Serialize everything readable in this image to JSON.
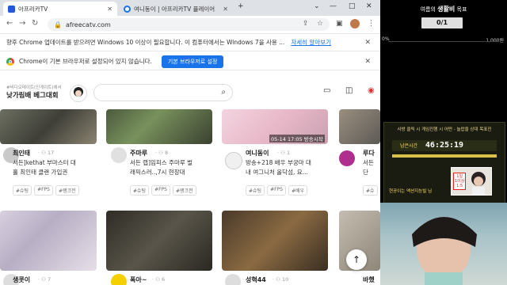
{
  "tabs": [
    {
      "label": "아프리카TV",
      "active": true
    },
    {
      "label": "여니동이 | 아프리카TV 플레이어",
      "active": false
    }
  ],
  "url": "afreecatv.com",
  "update_bar": {
    "text": "향후 Chrome 업데이트를 받으려면 Windows 10 이상이 필요합니다. 이 컴퓨터에서는 Windows 7을 사용 ...",
    "link": "자세히 알아보기"
  },
  "default_bar": {
    "text": "Chrome이 기본 브라우저로 설정되어 있지 않습니다.",
    "button": "기본 브라우저로 설정"
  },
  "header": {
    "logo_small": "#비디오테이트(인게이트)에서",
    "logo_big": "낮가림배 베그대회"
  },
  "cards_row1": [
    {
      "name": "최인태",
      "views": "17",
      "title1": "서든]kethat 부마스터 대",
      "title2": "홀 최인태 클랜 가입권",
      "tags": [
        "#슈팅",
        "#FPS",
        "#랭크전"
      ]
    },
    {
      "name": "주마루",
      "views": "8",
      "title1": "서든 랩]임피스 주마루 벌",
      "title2": "래픽스러..,7시 현장대",
      "tags": [
        "#슈팅",
        "#FPS",
        "#랭크전"
      ]
    },
    {
      "name": "여니동이",
      "views": "1",
      "title1": "방송+218 배우 부궁마 대",
      "title2": "내 여그니처 올닥섬, 요...",
      "tags": [
        "#슈팅",
        "#FPS",
        "#배우"
      ],
      "overlay": "05-14 17:05 방송시작"
    },
    {
      "name": "루다",
      "views": "",
      "title1": "서든",
      "title2": "단",
      "tags": [
        "#슈"
      ]
    }
  ],
  "cards_row2": [
    {
      "name": "생콧이",
      "views": "7"
    },
    {
      "name": "폭아~",
      "views": "6"
    },
    {
      "name": "성혁44",
      "views": "10"
    },
    {
      "name": "바했",
      "views": ""
    }
  ],
  "side": {
    "goal_title_prefix": "여름의",
    "goal_title_main": "생활비",
    "goal_title_suffix": "목표",
    "goal_box": "0/1",
    "goal_min": "0%",
    "goal_max": "1,000원",
    "timer_caption": "사방 클릭 시 게임진행 시 어떤 - 놀랍을 상대 목표진",
    "timer_sub": "",
    "timer_label": "남은시간",
    "timer_value": "46:25:19",
    "quest": "현공이는 액션지능빌 님",
    "cam_badge_line1": "1일",
    "cam_badge_line2": "1이상",
    "cam_badge_line3": "1:5"
  }
}
